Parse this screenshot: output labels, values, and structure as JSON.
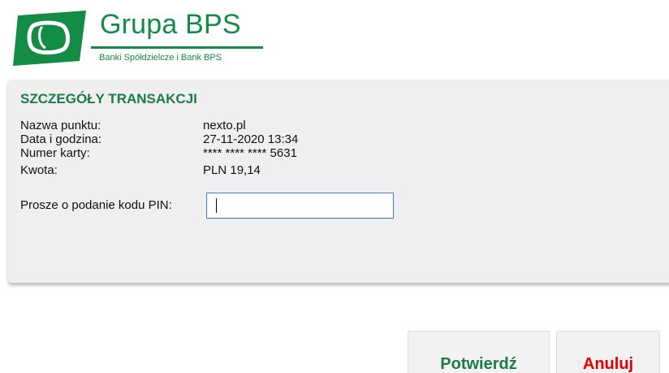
{
  "brand": {
    "name": "Grupa BPS",
    "subtitle": "Banki Spółdzielcze i Bank BPS",
    "color": "#138c45"
  },
  "transaction": {
    "title": "SZCZEGÓŁY TRANSAKCJI",
    "merchant_label": "Nazwa punktu:",
    "merchant_value": "nexto.pl",
    "datetime_label": "Data i godzina:",
    "datetime_value": "27-11-2020 13:34",
    "card_label": "Numer karty:",
    "card_value": "**** **** **** 5631",
    "amount_label": "Kwota:",
    "amount_value": "PLN 19,14",
    "pin_label": "Prosze o podanie kodu PIN:",
    "pin_value": ""
  },
  "buttons": {
    "confirm": "Potwierdź",
    "cancel": "Anuluj",
    "confirm_color": "#1d7a49",
    "cancel_color": "#e00000"
  }
}
